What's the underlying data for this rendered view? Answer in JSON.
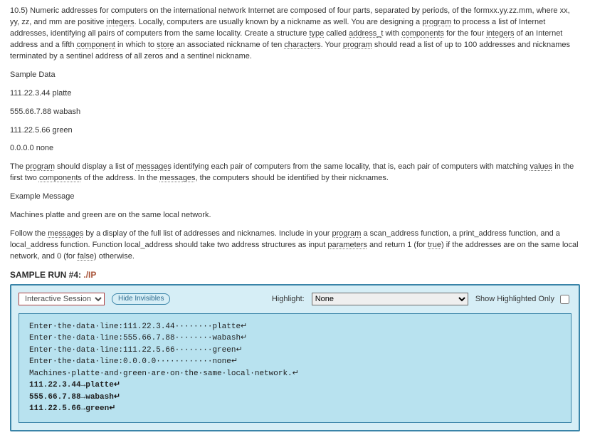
{
  "problem": {
    "paragraph1": {
      "lead": "10.5) Numeric addresses for computers on the international network Internet are composed of four parts, separated by periods, of the form",
      "template": "xx.yy.zz.mm, where xx, yy, zz, and mm are positive ",
      "u_integers": "integers",
      "after_integers": ". Locally, computers are usually known by a nickname as well. You are designing a ",
      "u_program1": "program",
      "after_program1": " to process a list of Internet addresses, identifying all pairs of computers from the same locality. Create a structure ",
      "u_type": "type",
      "after_type": " called ",
      "u_address_t": "address_t",
      "after_address_t": " with ",
      "u_components": "components",
      "after_components": " for the four ",
      "u_integers2": "integers",
      "after_integers2": " of an Internet address and a fifth ",
      "u_component2": "component",
      "after_component2": " in which to ",
      "u_store": "store",
      "after_store": " an associated nickname of ten ",
      "u_characters": "characters",
      "after_characters": ". Your ",
      "u_program2": "program",
      "after_program2": " should read a list of up to 100 addresses and nicknames terminated by a sentinel address of all zeros and a sentinel nickname."
    },
    "sample_data_label": "Sample Data",
    "sample_data": [
      "111.22.3.44 platte",
      "555.66.7.88 wabash",
      "111.22.5.66 green",
      "0.0.0.0 none"
    ],
    "paragraph2": {
      "t1": "The ",
      "u_program": "program",
      "t2": " should display a list of ",
      "u_messages": "messages",
      "t3": " identifying each pair of computers from the same locality, that is, each pair of computers with matching ",
      "u_values": "values",
      "t4": " in the first two ",
      "u_components": "components",
      "t5": " of the address. In the ",
      "u_messages2": "messages",
      "t6": ", the computers should be identified by their nicknames."
    },
    "example_label": "Example Message",
    "example_line": "Machines platte and green are on the same local network.",
    "paragraph3": {
      "t1": "Follow the ",
      "u_messages": "messages",
      "t2": " by a display of the full list of addresses and nicknames. Include in your ",
      "u_program": "program",
      "t3": " a scan_address function, a print_address function, and a local_address function. Function local_address should take two address structures as input ",
      "u_parameters": "parameters",
      "t4": " and return 1 (for ",
      "u_true": "true",
      "t5": ") if the addresses are on the same local network, and 0 (for ",
      "u_false": "false",
      "t6": ") otherwise."
    }
  },
  "run": {
    "header_label": "SAMPLE RUN #4: ",
    "header_cmd": "./IP"
  },
  "toolbar": {
    "session_option": "Interactive Session",
    "hide_invisibles": "Hide Invisibles",
    "highlight_label": "Highlight:",
    "highlight_option": "None",
    "show_highlighted": "Show Highlighted Only"
  },
  "console_lines": [
    "Enter·the·data·line:111.22.3.44········platte↵",
    "Enter·the·data·line:555.66.7.88········wabash↵",
    "Enter·the·data·line:111.22.5.66········green↵",
    "Enter·the·data·line:0.0.0.0············none↵",
    "Machines·platte·and·green·are·on·the·same·local·network.↵",
    "111.22.3.44→platte↵",
    "555.66.7.88→wabash↵",
    "111.22.5.66→green↵"
  ]
}
